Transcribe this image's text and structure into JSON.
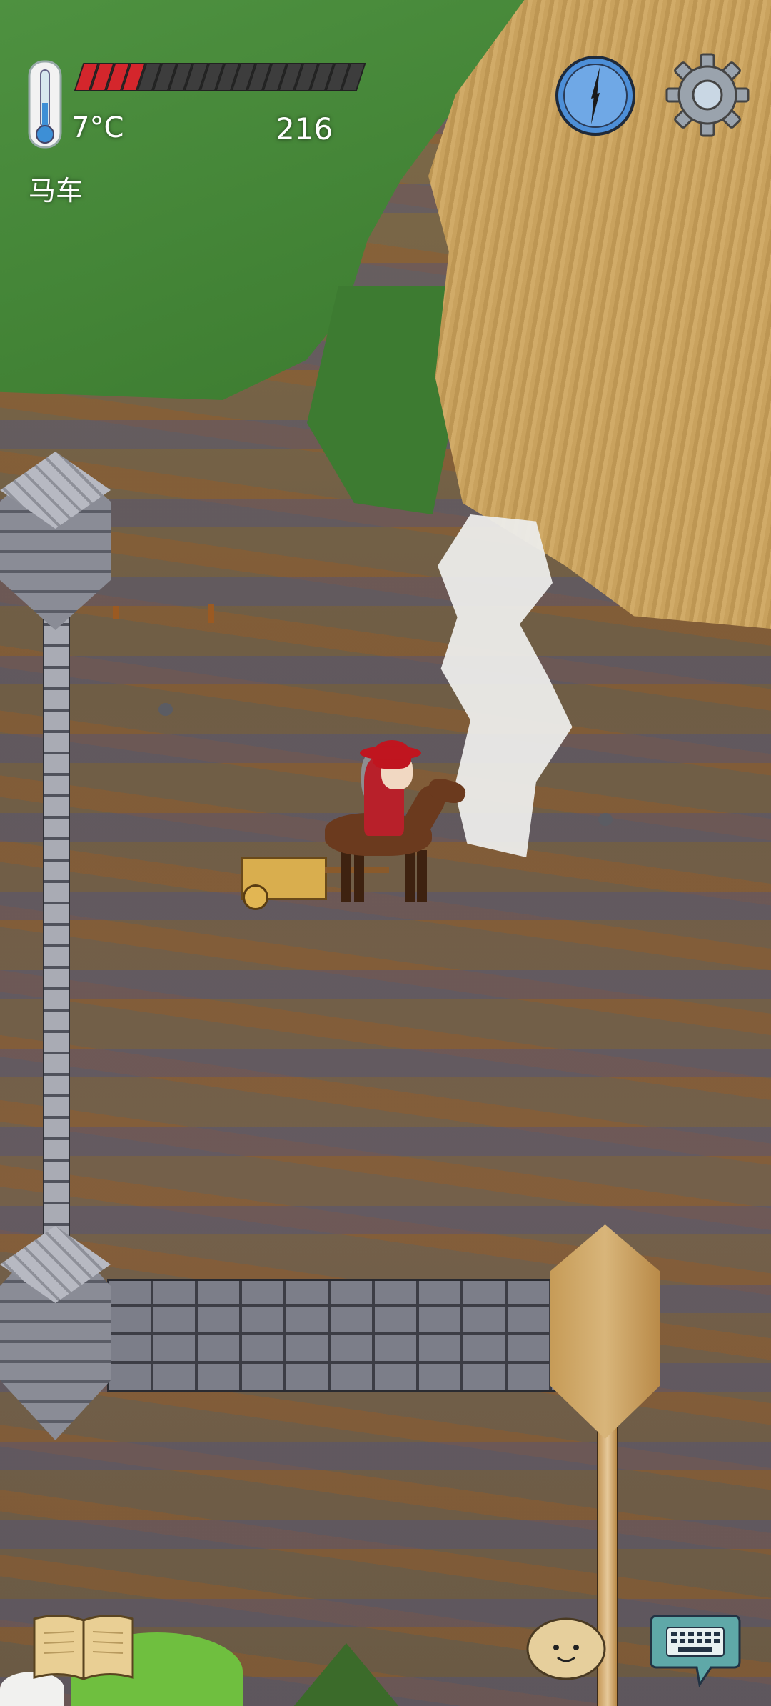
{
  "hud": {
    "temperature": "7°C",
    "score": "216",
    "held_item": "马车",
    "hunger": {
      "filled_segments": 4,
      "total_segments": 18
    }
  },
  "icons": {
    "thermometer": "thermometer-icon",
    "compass": "compass-icon",
    "settings": "gear-icon",
    "book": "book-icon",
    "emote": "emote-face-icon",
    "keyboard": "keyboard-chat-icon"
  },
  "colors": {
    "hunger_fill": "#d4262c",
    "hunger_empty": "#3d3d3d",
    "compass_blue": "#4d8fd8",
    "keyboard_bubble": "#5fa8a8"
  }
}
